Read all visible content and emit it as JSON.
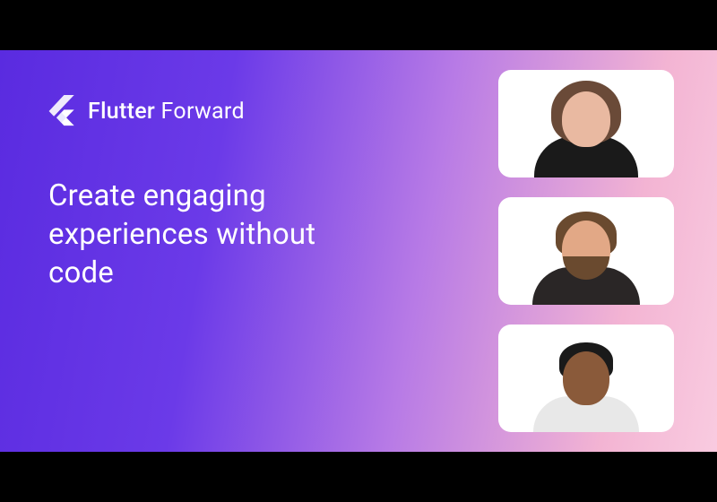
{
  "brand": {
    "name": "Flutter",
    "event": "Forward"
  },
  "headline": "Create engaging experiences without code",
  "speakers": [
    {
      "id": "speaker-1"
    },
    {
      "id": "speaker-2"
    },
    {
      "id": "speaker-3"
    }
  ]
}
